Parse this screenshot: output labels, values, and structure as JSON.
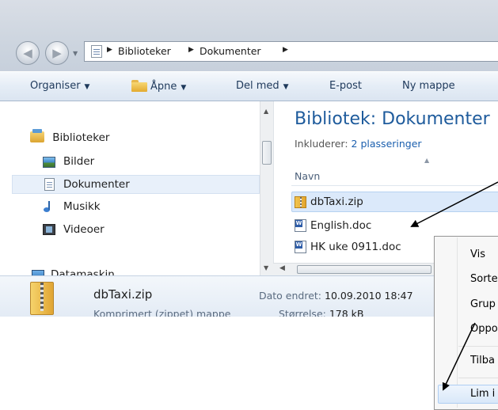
{
  "breadcrumbs": [
    "Biblioteker",
    "Dokumenter"
  ],
  "toolbar": {
    "organise": "Organiser",
    "open": "Åpne",
    "share": "Del med",
    "email": "E-post",
    "new_folder": "Ny mappe"
  },
  "nav": {
    "libraries": "Biblioteker",
    "items": [
      "Bilder",
      "Dokumenter",
      "Musikk",
      "Videoer"
    ],
    "computer": "Datamaskin"
  },
  "content": {
    "title": "Bibliotek: Dokumenter",
    "includes_label": "Inkluderer:",
    "includes_link": "2 plasseringer",
    "column_name": "Navn",
    "files": [
      "dbTaxi.zip",
      "English.doc",
      "HK uke 0911.doc"
    ]
  },
  "status": {
    "filename": "dbTaxi.zip",
    "type": "Komprimert (zippet) mappe",
    "modified_label": "Dato endret:",
    "modified_value": "10.09.2010 18:47",
    "size_label": "Størrelse:",
    "size_value": "178 kB"
  },
  "context_menu": [
    "Vis",
    "Sorte",
    "Grup",
    "Oppo",
    "Tilba",
    "Lim i"
  ]
}
